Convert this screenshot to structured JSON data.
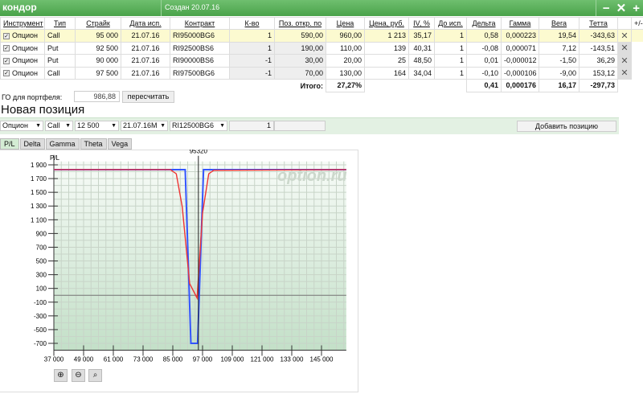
{
  "header": {
    "title": "кондор",
    "created": "Создан 20.07.16",
    "buttons": [
      "−",
      "✕",
      "+"
    ]
  },
  "table": {
    "columns": [
      "Инструмент",
      "Тип",
      "Страйк",
      "Дата исп.",
      "Контракт",
      "К-во",
      "Поз. откр. по",
      "Цена",
      "Цена, руб.",
      "IV, %",
      "До исп.",
      "Дельта",
      "Гамма",
      "Вега",
      "Тетта",
      "+/-"
    ],
    "rows": [
      {
        "checked": true,
        "instrument": "Опцион",
        "type": "Call",
        "strike": "95 000",
        "date": "21.07.16",
        "contract": "RI95000BG6",
        "qty": "1",
        "open": "590,00",
        "price": "960,00",
        "price_rub": "1 213",
        "iv": "35,17",
        "days": "1",
        "delta": "0,58",
        "gamma": "0,000223",
        "vega": "19,54",
        "theta": "-343,63"
      },
      {
        "checked": true,
        "instrument": "Опцион",
        "type": "Put",
        "strike": "92 500",
        "date": "21.07.16",
        "contract": "RI92500BS6",
        "qty": "1",
        "open": "190,00",
        "price": "110,00",
        "price_rub": "139",
        "iv": "40,31",
        "days": "1",
        "delta": "-0,08",
        "gamma": "0,000071",
        "vega": "7,12",
        "theta": "-143,51"
      },
      {
        "checked": true,
        "instrument": "Опцион",
        "type": "Put",
        "strike": "90 000",
        "date": "21.07.16",
        "contract": "RI90000BS6",
        "qty": "-1",
        "open": "30,00",
        "price": "20,00",
        "price_rub": "25",
        "iv": "48,50",
        "days": "1",
        "delta": "0,01",
        "gamma": "-0,000012",
        "vega": "-1,50",
        "theta": "36,29"
      },
      {
        "checked": true,
        "instrument": "Опцион",
        "type": "Call",
        "strike": "97 500",
        "date": "21.07.16",
        "contract": "RI97500BG6",
        "qty": "-1",
        "open": "70,00",
        "price": "130,00",
        "price_rub": "164",
        "iv": "34,04",
        "days": "1",
        "delta": "-0,10",
        "gamma": "-0,000106",
        "vega": "-9,00",
        "theta": "153,12"
      }
    ],
    "totals": {
      "label": "Итого:",
      "price": "27,27%",
      "delta": "0,41",
      "gamma": "0,000176",
      "vega": "16,17",
      "theta": "-297,73"
    }
  },
  "go": {
    "label": "ГО для портфеля:",
    "value": "986,88",
    "recalc": "пересчитать"
  },
  "new_position": {
    "title": "Новая позиция",
    "instrument": "Опцион",
    "type": "Call",
    "strike": "12 500",
    "date": "21.07.16M",
    "contract": "RI12500BG6",
    "qty": "1",
    "price": "",
    "add": "Добавить позицию"
  },
  "tabs": [
    "P/L",
    "Delta",
    "Gamma",
    "Theta",
    "Vega"
  ],
  "chart_data": {
    "type": "line",
    "ylabel": "P/L",
    "watermark": "option.ru",
    "marker": {
      "x": 95320,
      "label": "95320"
    },
    "xlim": [
      37000,
      155000
    ],
    "ylim": [
      -800,
      1950
    ],
    "xticks": [
      37000,
      49000,
      61000,
      73000,
      85000,
      97000,
      109000,
      121000,
      133000,
      145000
    ],
    "xtick_labels": [
      "37 000",
      "49 000",
      "61 000",
      "73 000",
      "85 000",
      "97 000",
      "109 000",
      "121 000",
      "133 000",
      "145 000"
    ],
    "yticks": [
      1900,
      1700,
      1500,
      1300,
      1100,
      900,
      700,
      500,
      300,
      100,
      -100,
      -300,
      -500,
      -700
    ],
    "ytick_labels": [
      "1 900",
      "1 700",
      "1 500",
      "1 300",
      "1 100",
      "900",
      "700",
      "500",
      "300",
      "100",
      "-100",
      "-300",
      "-500",
      "-700"
    ],
    "grid": true,
    "series": [
      {
        "color": "#3355ff",
        "x": [
          37000,
          90000,
          92300,
          95000,
          97400,
          155000
        ],
        "y": [
          1830,
          1830,
          -700,
          -700,
          1830,
          1830
        ]
      },
      {
        "color": "#ee3333",
        "x": [
          37000,
          84000,
          86400,
          88800,
          91800,
          94800,
          97000,
          99500,
          101500,
          155000
        ],
        "y": [
          1830,
          1830,
          1770,
          1290,
          170,
          -40,
          1200,
          1770,
          1820,
          1830
        ]
      }
    ]
  },
  "zoom": {
    "buttons": [
      "zoom-in",
      "zoom-out",
      "zoom-fit"
    ]
  }
}
